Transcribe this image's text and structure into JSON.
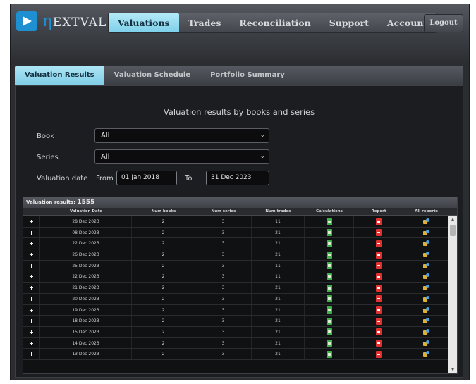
{
  "app": {
    "logo_text": "EXTVAL",
    "logo_initial": "η",
    "logout_label": "Logout"
  },
  "nav": [
    {
      "label": "Valuations",
      "active": true
    },
    {
      "label": "Trades",
      "active": false
    },
    {
      "label": "Reconciliation",
      "active": false
    },
    {
      "label": "Support",
      "active": false
    },
    {
      "label": "Account",
      "active": false
    }
  ],
  "subtabs": [
    {
      "label": "Valuation Results",
      "active": true
    },
    {
      "label": "Valuation Schedule",
      "active": false
    },
    {
      "label": "Portfolio Summary",
      "active": false
    }
  ],
  "form": {
    "title": "Valuation results by books and series",
    "book_label": "Book",
    "book_value": "All",
    "series_label": "Series",
    "series_value": "All",
    "date_label": "Valuation date",
    "from_label": "From",
    "from_value": "01 Jan 2018",
    "to_label": "To",
    "to_value": "31 Dec 2023"
  },
  "results": {
    "caption_prefix": "Valuation results:",
    "count": "1555",
    "columns": [
      "",
      "Valuation Date",
      "Num books",
      "Num series",
      "Num trades",
      "Calculations",
      "Report",
      "All reports"
    ],
    "rows": [
      {
        "date": "28 Dec 2023",
        "books": "2",
        "series": "3",
        "trades": "11"
      },
      {
        "date": "08 Dec 2023",
        "books": "2",
        "series": "3",
        "trades": "21"
      },
      {
        "date": "22 Dec 2023",
        "books": "2",
        "series": "3",
        "trades": "21"
      },
      {
        "date": "26 Dec 2023",
        "books": "2",
        "series": "3",
        "trades": "21"
      },
      {
        "date": "25 Dec 2023",
        "books": "2",
        "series": "3",
        "trades": "11"
      },
      {
        "date": "22 Dec 2023",
        "books": "2",
        "series": "3",
        "trades": "11"
      },
      {
        "date": "21 Dec 2023",
        "books": "2",
        "series": "3",
        "trades": "21"
      },
      {
        "date": "20 Dec 2023",
        "books": "2",
        "series": "3",
        "trades": "21"
      },
      {
        "date": "19 Dec 2023",
        "books": "2",
        "series": "3",
        "trades": "21"
      },
      {
        "date": "18 Dec 2023",
        "books": "2",
        "series": "3",
        "trades": "21"
      },
      {
        "date": "15 Dec 2023",
        "books": "2",
        "series": "3",
        "trades": "21"
      },
      {
        "date": "14 Dec 2023",
        "books": "2",
        "series": "3",
        "trades": "21"
      },
      {
        "date": "13 Dec 2023",
        "books": "2",
        "series": "3",
        "trades": "21"
      }
    ]
  },
  "icons": {
    "calculations": "spreadsheet-icon",
    "report": "pdf-icon",
    "all_reports": "reports-bundle-icon"
  },
  "colors": {
    "accent": "#7fcde6",
    "brand": "#1e8fd0",
    "background": "#1c1d20"
  }
}
